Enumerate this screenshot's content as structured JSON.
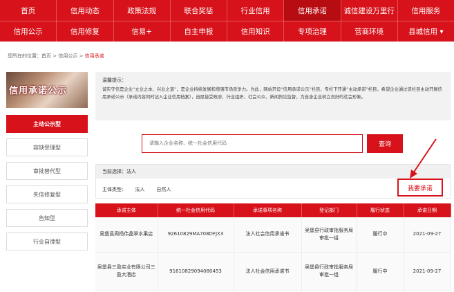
{
  "nav": {
    "row1": [
      "首页",
      "信用动态",
      "政策法规",
      "联合奖惩",
      "行业信用",
      "信用承诺",
      "诚信建设万里行",
      "信用服务"
    ],
    "row2": [
      "信用公示",
      "信用修复",
      "信易+",
      "自主申报",
      "信用知识",
      "专项治理",
      "营商环境",
      "县城信用 ▾"
    ]
  },
  "breadcrumb": {
    "prefix": "您所在的位置：",
    "home": "首页",
    "sep1": " > ",
    "mid": "信用公示",
    "sep2": " > ",
    "current": "信用承诺"
  },
  "banner": {
    "title": "信用承诺公示"
  },
  "sidebar": {
    "items": [
      "主动公示型",
      "容缺受理型",
      "审批替代型",
      "失信修复型",
      "告知型",
      "行业自律型"
    ]
  },
  "tip": {
    "title": "温馨提示：",
    "text": "诚实守信是企业“立业之本、兴业之道”，是企业持续发展和增强市场竞争力。为此，网站开设“信用承诺公示”栏目，专栏下开通“主动承诺”栏目，希望企业通过该栏目主动开展信用承诺公示（承诺内容同时记入企业信用档案），自愿接受政府、行业组织、社会公众、新闻舆论监督，为自身企业树立良好的社会形象。"
  },
  "search": {
    "placeholder": "请输入企业名称、统一社会信用代码",
    "button": "查询"
  },
  "filter": {
    "selected_label": "当前选择：",
    "selected_value": "法人",
    "type_label": "主体类型:",
    "options": [
      "法人",
      "自然人"
    ]
  },
  "pledge_button": "我要承诺",
  "table": {
    "columns": [
      "承诺主体",
      "统一社会信用代码",
      "承诺事项名称",
      "登记部门",
      "履行状态",
      "承诺日期"
    ],
    "rows": [
      [
        "吴堡县周杨伟晶翠水果店",
        "92610829MA708DFJX3",
        "法人社会信用承诺书",
        "吴堡县行政审批服务局审批一组",
        "履行中",
        "2021-09-27"
      ],
      [
        "吴堡县三盈实业有限公司三盈大酒店",
        "91610829094080453",
        "法人社会信用承诺书",
        "吴堡县行政审批服务局审批一组",
        "履行中",
        "2021-09-27"
      ]
    ]
  },
  "colors": {
    "brand_red": "#d7121a"
  }
}
